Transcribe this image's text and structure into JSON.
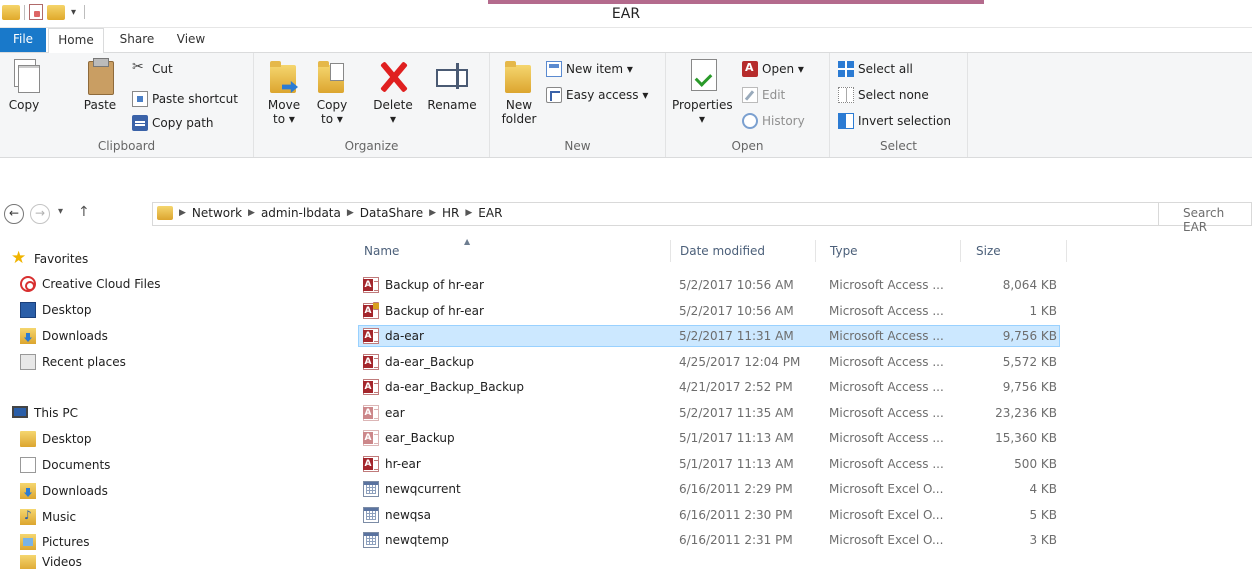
{
  "window": {
    "title": "EAR"
  },
  "ribbon_tabs": {
    "file": "File",
    "home": "Home",
    "share": "Share",
    "view": "View"
  },
  "ribbon": {
    "clipboard": {
      "label": "Clipboard",
      "copy": "Copy",
      "paste": "Paste",
      "cut": "Cut",
      "copy_path": "Copy path",
      "paste_shortcut": "Paste shortcut"
    },
    "organize": {
      "label": "Organize",
      "move_to": "Move to ▾",
      "move_to_line1": "Move",
      "move_to_line2": "to ▾",
      "copy_to_line1": "Copy",
      "copy_to_line2": "to ▾",
      "delete": "Delete",
      "delete_arrow": "▾",
      "rename": "Rename"
    },
    "new": {
      "label": "New",
      "new_folder_line1": "New",
      "new_folder_line2": "folder",
      "new_item": "New item ▾",
      "easy_access": "Easy access ▾"
    },
    "open": {
      "label": "Open",
      "properties": "Properties",
      "properties_arrow": "▾",
      "open": "Open ▾",
      "edit": "Edit",
      "history": "History"
    },
    "select": {
      "label": "Select",
      "select_all": "Select all",
      "select_none": "Select none",
      "invert_selection": "Invert selection"
    }
  },
  "address": {
    "crumbs": [
      "Network",
      "admin-lbdata",
      "DataShare",
      "HR",
      "EAR"
    ],
    "search_placeholder": "Search EAR"
  },
  "nav": {
    "favorites": "Favorites",
    "favorites_items": [
      "Creative Cloud Files",
      "Desktop",
      "Downloads",
      "Recent places"
    ],
    "this_pc": "This PC",
    "pc_items": [
      "Desktop",
      "Documents",
      "Downloads",
      "Music",
      "Pictures",
      "Videos"
    ]
  },
  "columns": {
    "name": "Name",
    "date": "Date modified",
    "type": "Type",
    "size": "Size"
  },
  "files": [
    {
      "name": "Backup of hr-ear",
      "date": "5/2/2017 10:56 AM",
      "type": "Microsoft Access ...",
      "size": "8,064 KB",
      "icon": "access-icon"
    },
    {
      "name": "Backup of hr-ear",
      "date": "5/2/2017 10:56 AM",
      "type": "Microsoft Access ...",
      "size": "1 KB",
      "icon": "access-lock-icon"
    },
    {
      "name": "da-ear",
      "date": "5/2/2017 11:31 AM",
      "type": "Microsoft Access ...",
      "size": "9,756 KB",
      "icon": "access-icon",
      "selected": true
    },
    {
      "name": "da-ear_Backup",
      "date": "4/25/2017 12:04 PM",
      "type": "Microsoft Access ...",
      "size": "5,572 KB",
      "icon": "access-icon"
    },
    {
      "name": "da-ear_Backup_Backup",
      "date": "4/21/2017 2:52 PM",
      "type": "Microsoft Access ...",
      "size": "9,756 KB",
      "icon": "access-icon"
    },
    {
      "name": "ear",
      "date": "5/2/2017 11:35 AM",
      "type": "Microsoft Access ...",
      "size": "23,236 KB",
      "icon": "access-faded-icon"
    },
    {
      "name": "ear_Backup",
      "date": "5/1/2017 11:13 AM",
      "type": "Microsoft Access ...",
      "size": "15,360 KB",
      "icon": "access-faded-icon"
    },
    {
      "name": "hr-ear",
      "date": "5/1/2017 11:13 AM",
      "type": "Microsoft Access ...",
      "size": "500 KB",
      "icon": "access-icon"
    },
    {
      "name": "newqcurrent",
      "date": "6/16/2011 2:29 PM",
      "type": "Microsoft Excel O...",
      "size": "4 KB",
      "icon": "excel-icon"
    },
    {
      "name": "newqsa",
      "date": "6/16/2011 2:30 PM",
      "type": "Microsoft Excel O...",
      "size": "5 KB",
      "icon": "excel-icon"
    },
    {
      "name": "newqtemp",
      "date": "6/16/2011 2:31 PM",
      "type": "Microsoft Excel O...",
      "size": "3 KB",
      "icon": "excel-icon"
    }
  ],
  "colors": {
    "file_tab": "#1979ca",
    "selection": "#cce8ff",
    "selection_border": "#99d1ff",
    "accent": "#b46b8d"
  }
}
